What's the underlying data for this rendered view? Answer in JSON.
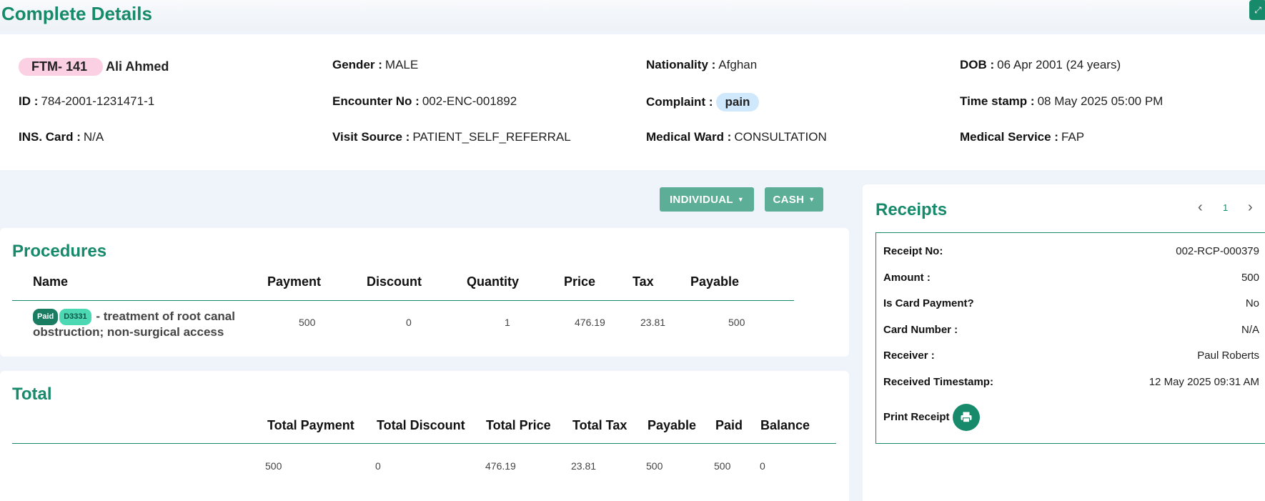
{
  "header": {
    "title": "Complete Details"
  },
  "patient": {
    "ftm": "FTM- 141",
    "name": "Ali Ahmed",
    "gender_label": "Gender :",
    "gender": "MALE",
    "nationality_label": "Nationality :",
    "nationality": "Afghan",
    "dob_label": "DOB :",
    "dob": "06 Apr 2001 (24 years)",
    "id_label": "ID :",
    "id": "784-2001-1231471-1",
    "encounter_label": "Encounter No :",
    "encounter": "002-ENC-001892",
    "complaint_label": "Complaint :",
    "complaint": "pain",
    "timestamp_label": "Time stamp :",
    "timestamp": "08 May 2025 05:00 PM",
    "ins_label": "INS. Card :",
    "ins": "N/A",
    "visit_label": "Visit Source :",
    "visit": "PATIENT_SELF_REFERRAL",
    "ward_label": "Medical Ward :",
    "ward": "CONSULTATION",
    "service_label": "Medical Service :",
    "service": "FAP"
  },
  "buttons": {
    "individual": "INDIVIDUAL",
    "cash": "CASH"
  },
  "procedures": {
    "title": "Procedures",
    "columns": [
      "Name",
      "Payment",
      "Discount",
      "Quantity",
      "Price",
      "Tax",
      "Payable"
    ],
    "rows": [
      {
        "status": "Paid",
        "code": "D3331",
        "name": "- treatment of root canal obstruction; non-surgical access",
        "payment": "500",
        "discount": "0",
        "quantity": "1",
        "price": "476.19",
        "tax": "23.81",
        "payable": "500"
      }
    ]
  },
  "total": {
    "title": "Total",
    "columns": [
      "Total Payment",
      "Total Discount",
      "Total Price",
      "Total Tax",
      "Payable",
      "Paid",
      "Balance"
    ],
    "values": [
      "500",
      "0",
      "476.19",
      "23.81",
      "500",
      "500",
      "0"
    ]
  },
  "receipts": {
    "title": "Receipts",
    "page": "1",
    "receipt_no_label": "Receipt No:",
    "receipt_no": "002-RCP-000379",
    "amount_label": "Amount :",
    "amount": "500",
    "card_payment_label": "Is Card Payment?",
    "card_payment": "No",
    "card_number_label": "Card Number :",
    "card_number": "N/A",
    "receiver_label": "Receiver :",
    "receiver": "Paul Roberts",
    "received_label": "Received Timestamp:",
    "received": "12 May 2025 09:31 AM",
    "print_label": "Print Receipt"
  },
  "colors": {
    "accent": "#178a6b",
    "button": "#5cae96",
    "ftm_badge": "#fbd0e2",
    "pain_badge": "#cfe8fb"
  },
  "icons": {
    "expand": "expand-icon",
    "print": "printer-icon",
    "prev": "chevron-left-icon",
    "next": "chevron-right-icon"
  }
}
